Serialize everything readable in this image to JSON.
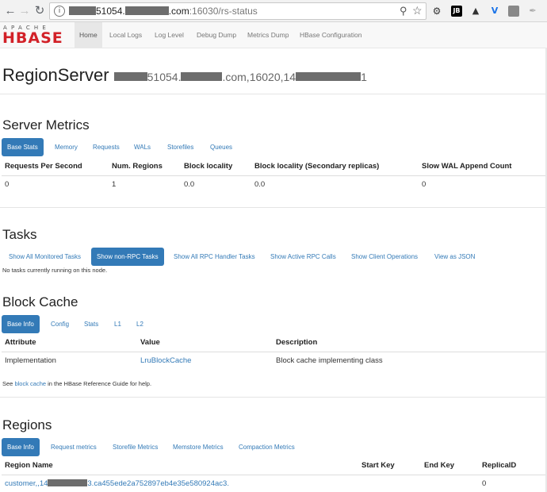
{
  "browser": {
    "url_host_mid": "51054.",
    "url_host_end": ".com",
    "url_path": ":16030/rs-status",
    "extensions": [
      {
        "icon": "gear-icon",
        "label": "",
        "color": "#333333"
      },
      {
        "icon": "jb-extension-icon",
        "label": "JB",
        "color": "#000000"
      },
      {
        "icon": "camera-icon",
        "label": "",
        "color": "#333333"
      },
      {
        "icon": "v-extension-icon",
        "label": "V",
        "color": "#1a73e8"
      },
      {
        "icon": "square-extension-icon",
        "label": "",
        "color": "#888888"
      },
      {
        "icon": "feather-icon",
        "label": "",
        "color": "#aaaaaa"
      }
    ]
  },
  "logo": {
    "line1": "APACHE",
    "line2": "HBASE"
  },
  "nav": {
    "home": "Home",
    "local_logs": "Local Logs",
    "log_level": "Log Level",
    "debug_dump": "Debug Dump",
    "metrics_dump": "Metrics Dump",
    "hbase_config": "HBase Configuration"
  },
  "header": {
    "title": "RegionServer",
    "id_mid": "51054.",
    "id_com": ".com,16020,14",
    "id_end": "1"
  },
  "server_metrics": {
    "title": "Server Metrics",
    "tabs": [
      "Base Stats",
      "Memory",
      "Requests",
      "WALs",
      "Storefiles",
      "Queues"
    ],
    "columns": [
      "Requests Per Second",
      "Num. Regions",
      "Block locality",
      "Block locality (Secondary replicas)",
      "Slow WAL Append Count"
    ],
    "row": [
      "0",
      "1",
      "0.0",
      "0.0",
      "0"
    ]
  },
  "tasks": {
    "title": "Tasks",
    "tabs": [
      "Show All Monitored Tasks",
      "Show non-RPC Tasks",
      "Show All RPC Handler Tasks",
      "Show Active RPC Calls",
      "Show Client Operations",
      "View as JSON"
    ],
    "message": "No tasks currently running on this node."
  },
  "block_cache": {
    "title": "Block Cache",
    "tabs": [
      "Base Info",
      "Config",
      "Stats",
      "L1",
      "L2"
    ],
    "columns": [
      "Attribute",
      "Value",
      "Description"
    ],
    "row": [
      "Implementation",
      "LruBlockCache",
      "Block cache implementing class"
    ],
    "note_prefix": "See ",
    "note_link": "block cache",
    "note_suffix": " in the HBase Reference Guide for help."
  },
  "regions": {
    "title": "Regions",
    "tabs": [
      "Base Info",
      "Request metrics",
      "Storefile Metrics",
      "Memstore Metrics",
      "Compaction Metrics"
    ],
    "columns": [
      "Region Name",
      "Start Key",
      "End Key",
      "ReplicaID"
    ],
    "region_prefix": "customer,,14",
    "region_suffix": "3.ca455ede2a752897eb4e35e580924ac3.",
    "start_key": "",
    "end_key": "",
    "replica_id": "0"
  }
}
